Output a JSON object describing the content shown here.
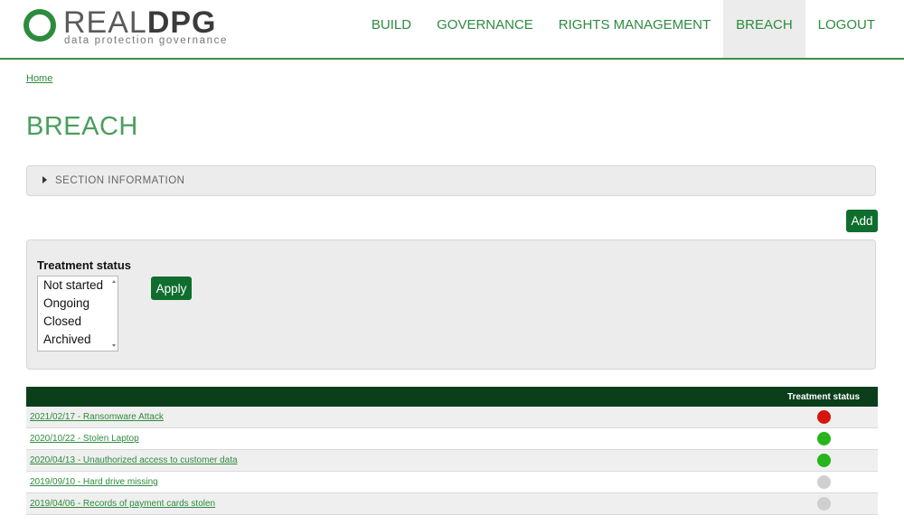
{
  "logo": {
    "brand_light": "REAL",
    "brand_bold": "DPG",
    "tagline": "data protection governance"
  },
  "nav": {
    "items": [
      {
        "label": "BUILD",
        "active": false
      },
      {
        "label": "GOVERNANCE",
        "active": false
      },
      {
        "label": "RIGHTS MANAGEMENT",
        "active": false
      },
      {
        "label": "BREACH",
        "active": true
      },
      {
        "label": "LOGOUT",
        "active": false
      }
    ]
  },
  "breadcrumb": {
    "home": "Home"
  },
  "page": {
    "title": "BREACH"
  },
  "section_info": {
    "label": "SECTION INFORMATION"
  },
  "actions": {
    "add_label": "Add"
  },
  "filter": {
    "label": "Treatment status",
    "options": [
      "Not started",
      "Ongoing",
      "Closed",
      "Archived"
    ],
    "apply_label": "Apply"
  },
  "table": {
    "headers": {
      "name": "",
      "status": "Treatment status"
    },
    "rows": [
      {
        "title": "2021/02/17 - Ransomware Attack",
        "status_color": "#d9140f"
      },
      {
        "title": "2020/10/22 - Stolen Laptop",
        "status_color": "#27b51b"
      },
      {
        "title": "2020/04/13 - Unauthorized access to customer data",
        "status_color": "#27b51b"
      },
      {
        "title": "2019/09/10 - Hard drive missing",
        "status_color": "#cfcfcf"
      },
      {
        "title": "2019/04/06 - Records of payment cards stolen",
        "status_color": "#cfcfcf"
      }
    ]
  },
  "colors": {
    "accent": "#2e8b3e",
    "button": "#0f6e2e",
    "table_header": "#0b3f1c"
  }
}
